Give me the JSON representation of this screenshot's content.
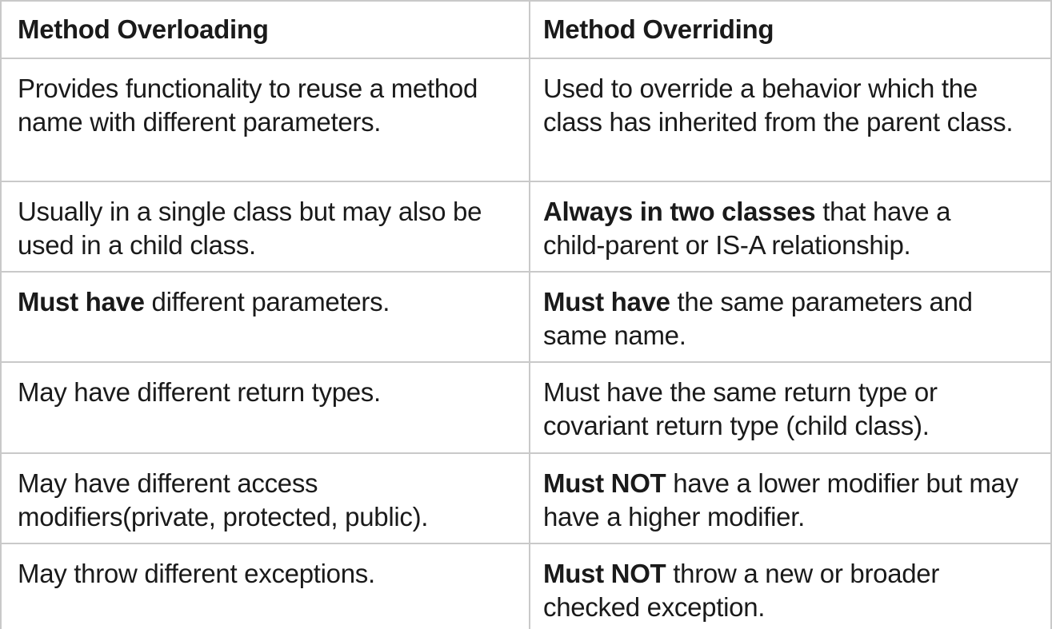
{
  "headers": {
    "left": "Method Overloading",
    "right": "Method Overriding"
  },
  "rows": [
    {
      "left": {
        "bold": "",
        "text": "Provides functionality to reuse a method name with different parameters."
      },
      "right": {
        "bold": "",
        "text": "Used to override a behavior which the class has inherited from the parent class."
      }
    },
    {
      "left": {
        "bold": "",
        "text": "Usually in a single class but may also be used in a child class."
      },
      "right": {
        "bold": "Always in two classes",
        "text": " that have a child-parent or IS-A relationship."
      }
    },
    {
      "left": {
        "bold": "Must have",
        "text": " different parameters."
      },
      "right": {
        "bold": "Must have",
        "text": " the same parameters and same name."
      }
    },
    {
      "left": {
        "bold": "",
        "text": "May have different return types."
      },
      "right": {
        "bold": "",
        "text": "Must have the same return type or covariant return type (child class)."
      }
    },
    {
      "left": {
        "bold": "",
        "text": "May have different access modifiers(private, protected, public)."
      },
      "right": {
        "bold": "Must NOT",
        "text": " have a lower modifier but may have a higher modifier."
      }
    },
    {
      "left": {
        "bold": "",
        "text": "May throw different exceptions."
      },
      "right": {
        "bold": "Must NOT",
        "text": " throw a new or broader checked exception."
      }
    }
  ]
}
